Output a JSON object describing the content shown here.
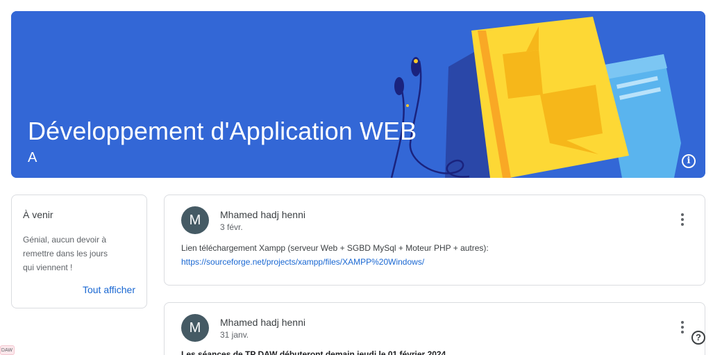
{
  "banner": {
    "title": "Développement d'Application WEB",
    "subtitle": "A",
    "color": "#3367d6",
    "info_icon": "info-icon"
  },
  "upcoming": {
    "title": "À venir",
    "message": "Génial, aucun devoir à remettre dans les jours qui viennent !",
    "view_all_label": "Tout afficher"
  },
  "posts": [
    {
      "avatar_letter": "M",
      "author": "Mhamed hadj henni",
      "date": "3 févr.",
      "text": "Lien téléchargement Xampp (serveur Web + SGBD MySql + Moteur PHP + autres):",
      "link": "https://sourceforge.net/projects/xampp/files/XAMPP%20Windows/"
    },
    {
      "avatar_letter": "M",
      "author": "Mhamed hadj henni",
      "date": "31 janv.",
      "text": "Les séances de TP DAW débuteront demain jeudi le 01 février 2024"
    }
  ],
  "help_icon": "help-icon",
  "edge_badge": "DAW"
}
